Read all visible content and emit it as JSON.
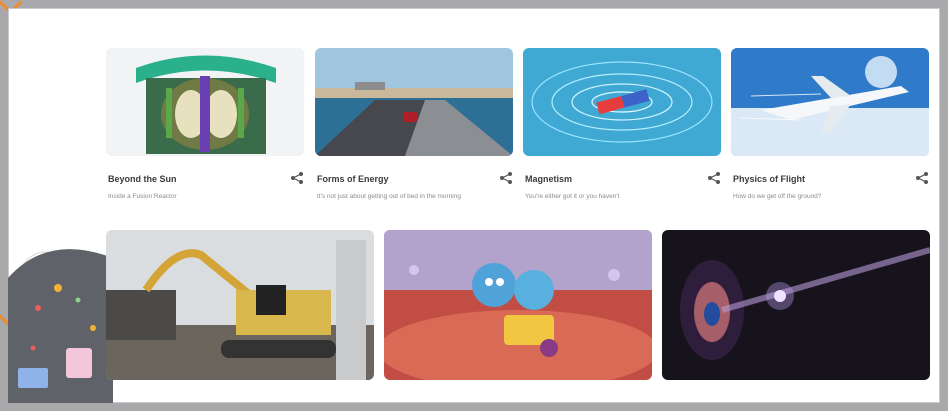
{
  "section": {
    "title": ""
  },
  "cards_row1": [
    {
      "title": "Beyond the Sun",
      "subtitle": "Inside a Fusion Reactor"
    },
    {
      "title": "Forms of Energy",
      "subtitle": "It's not just about getting out of bed in the morning"
    },
    {
      "title": "Magnetism",
      "subtitle": "You're either got it or you haven't"
    },
    {
      "title": "Physics of Flight",
      "subtitle": "How do we get off the ground?"
    }
  ],
  "icons": {
    "share": "share-icon",
    "nav_arrow": "chevron-icon"
  },
  "colors": {
    "accent": "#f08a2c",
    "frame": "#a9a9ab",
    "card_title": "#3b3b3b",
    "card_subtitle": "#8b8b8b"
  }
}
